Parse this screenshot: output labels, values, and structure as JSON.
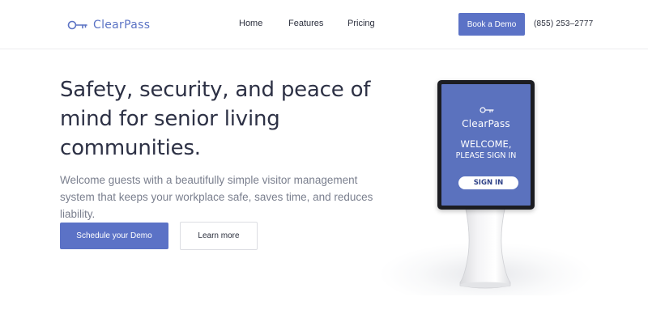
{
  "header": {
    "logo_text": "ClearPass",
    "nav": [
      "Home",
      "Features",
      "Pricing"
    ],
    "cta_label": "Book a Demo",
    "phone": "(855) 253–2777"
  },
  "hero": {
    "headline": "Safety, security, and peace of mind for senior living communities.",
    "subtext": "Welcome guests with a beautifully simple visitor management system that keeps your workplace safe, saves time, and reduces liability.",
    "primary_cta": "Schedule your Demo",
    "secondary_cta": "Learn more"
  },
  "kiosk": {
    "brand": "ClearPass",
    "welcome_line1": "WELCOME,",
    "welcome_line2": "PLEASE SIGN IN",
    "signin_label": "SIGN IN"
  },
  "colors": {
    "brand": "#5b72c6",
    "text": "#2d3145",
    "muted": "#7a7f8e"
  },
  "icons": {
    "logo": "key-icon"
  }
}
